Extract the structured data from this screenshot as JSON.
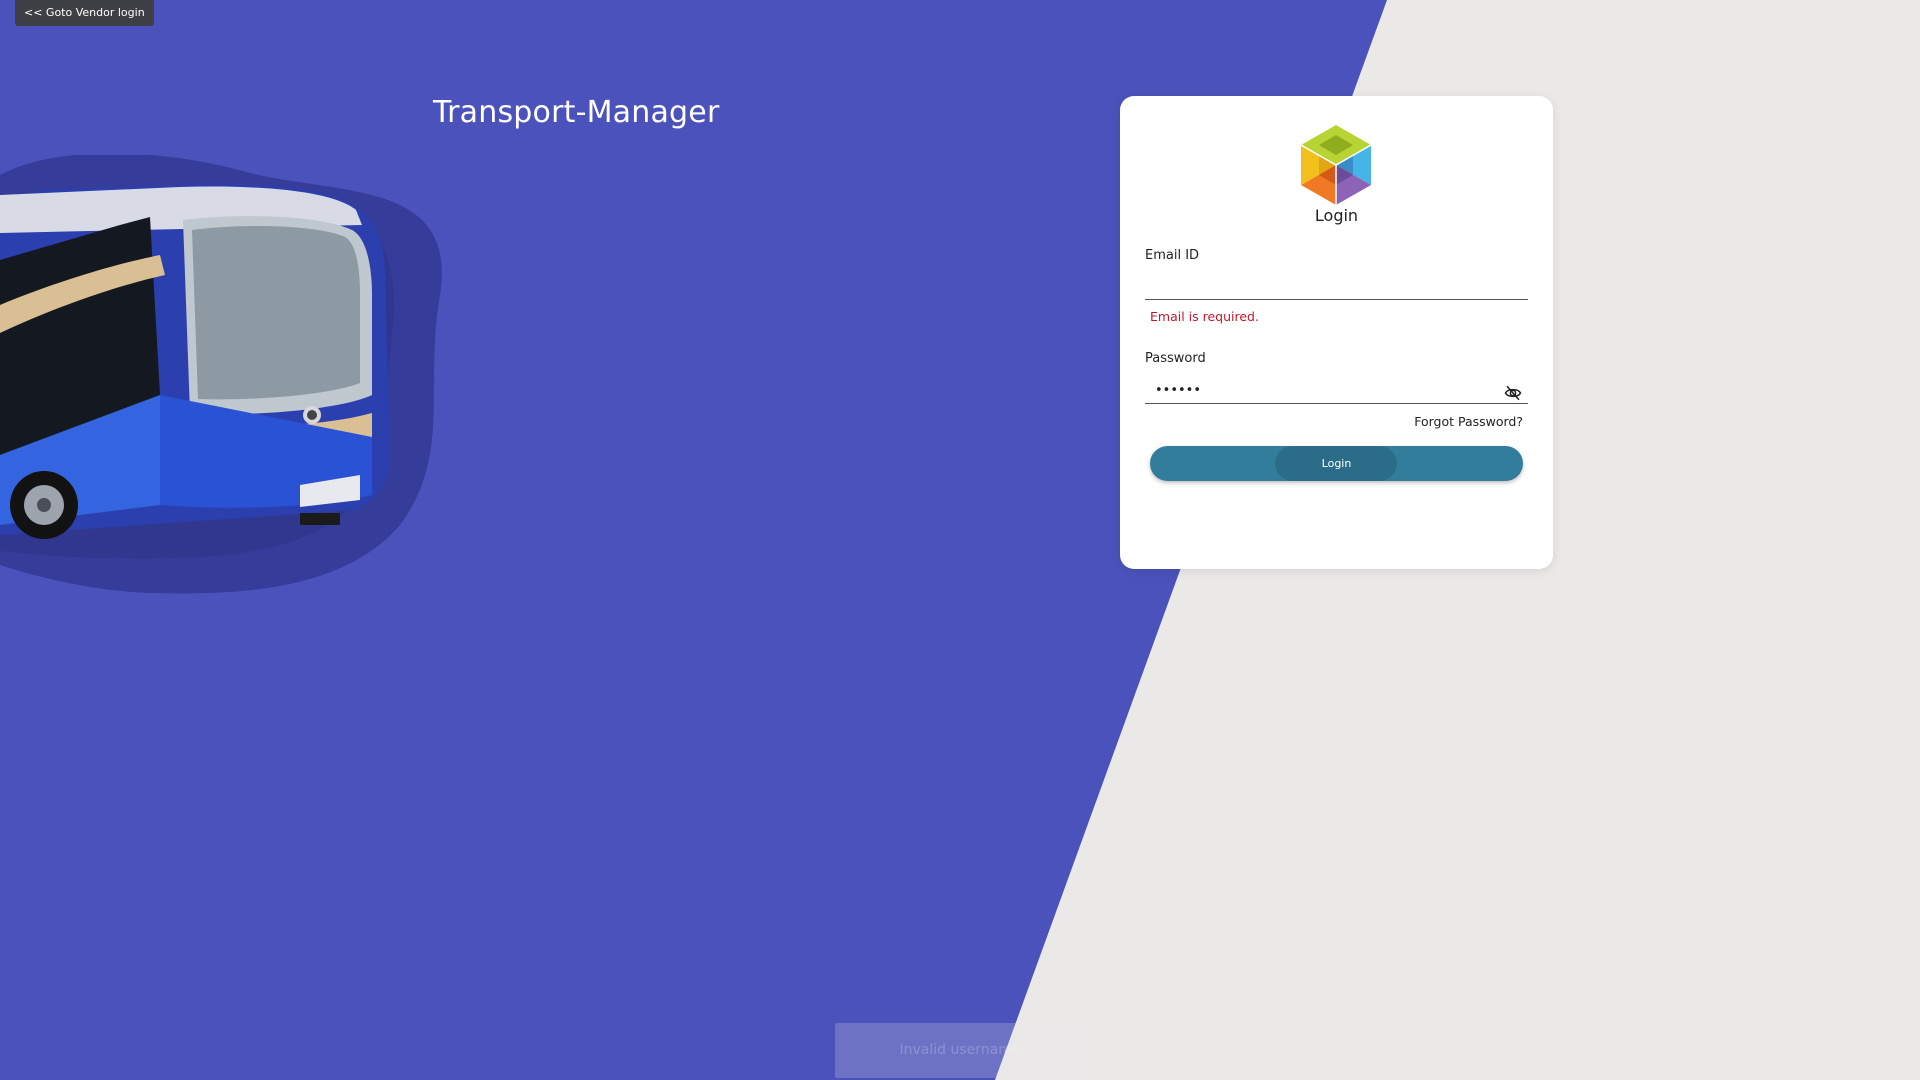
{
  "header": {
    "vendor_login_label": "<< Goto Vendor login",
    "app_title": "Transport-Manager"
  },
  "login_form": {
    "heading": "Login",
    "email": {
      "label": "Email ID",
      "value": "",
      "error": "Email is required."
    },
    "password": {
      "label": "Password",
      "value": "••••••",
      "visibility_icon": "eye-off-icon"
    },
    "forgot_password_label": "Forgot Password?",
    "submit_label": "Login"
  },
  "toast": {
    "message": "Invalid username"
  },
  "colors": {
    "primary_blue": "#4b52bb",
    "background_grey": "#ebe9e8",
    "button_teal": "#327d9b",
    "error_red": "#c5162e"
  }
}
